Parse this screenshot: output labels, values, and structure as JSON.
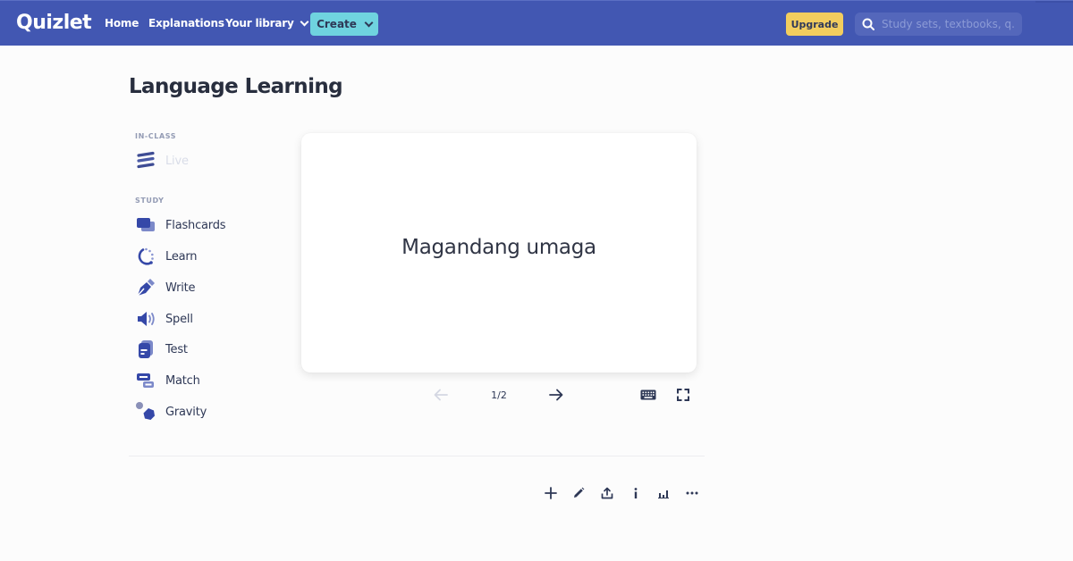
{
  "header": {
    "logo": "Quizlet",
    "nav": {
      "home": "Home",
      "explanations": "Explanations",
      "library": "Your library"
    },
    "create_label": "Create",
    "upgrade_label": "Upgrade",
    "search_placeholder": "Study sets, textbooks, q...",
    "colors": {
      "bar": "#4257b2",
      "create": "#6fd3df",
      "upgrade": "#fcd45a"
    }
  },
  "page": {
    "title": "Language Learning"
  },
  "sidebar": {
    "in_class_label": "IN-CLASS",
    "live": {
      "label": "Live",
      "icon": "live-icon",
      "disabled": true
    },
    "study_label": "STUDY",
    "modes": [
      {
        "label": "Flashcards",
        "icon": "flashcards-icon"
      },
      {
        "label": "Learn",
        "icon": "learn-icon"
      },
      {
        "label": "Write",
        "icon": "write-icon"
      },
      {
        "label": "Spell",
        "icon": "spell-icon"
      },
      {
        "label": "Test",
        "icon": "test-icon"
      },
      {
        "label": "Match",
        "icon": "match-icon"
      },
      {
        "label": "Gravity",
        "icon": "gravity-icon"
      }
    ]
  },
  "flashcard": {
    "term": "Magandang umaga",
    "counter": "1/2",
    "current": 1,
    "total": 2
  },
  "card_controls": {
    "prev": "arrow-left-icon",
    "next": "arrow-right-icon",
    "keyboard": "keyboard-icon",
    "fullscreen": "fullscreen-icon"
  },
  "set_actions": [
    {
      "name": "add",
      "icon": "plus-icon"
    },
    {
      "name": "edit",
      "icon": "pencil-icon"
    },
    {
      "name": "share",
      "icon": "share-icon"
    },
    {
      "name": "info",
      "icon": "info-icon"
    },
    {
      "name": "stats",
      "icon": "bar-chart-icon"
    },
    {
      "name": "more",
      "icon": "more-icon"
    }
  ]
}
